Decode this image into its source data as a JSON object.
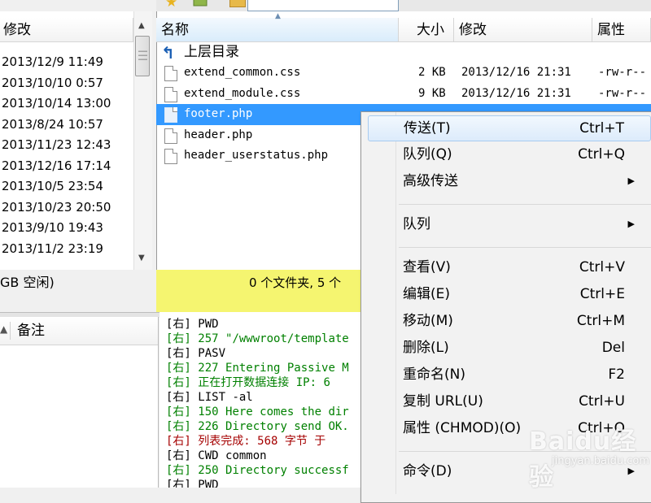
{
  "local": {
    "column_modified": "修改",
    "dates": [
      "2013/12/9 11:49",
      "2013/10/10 0:57",
      "2013/10/14 13:00",
      "2013/8/24 10:57",
      "2013/11/23 12:43",
      "2013/12/16 17:14",
      "2013/10/5 23:54",
      "2013/10/23 20:50",
      "2013/9/10 19:43",
      "2013/11/2 23:19"
    ],
    "status": "GB 空闲)"
  },
  "remote": {
    "columns": {
      "name": "名称",
      "size": "大小",
      "modified": "修改",
      "attr": "属性"
    },
    "parent_dir": "上层目录",
    "files": [
      {
        "name": "extend_common.css",
        "size": "2 KB",
        "modified": "2013/12/16 21:31",
        "perm": "-rw-r--"
      },
      {
        "name": "extend_module.css",
        "size": "9 KB",
        "modified": "2013/12/16 21:31",
        "perm": "-rw-r--"
      },
      {
        "name": "footer.php",
        "size": "",
        "modified": "",
        "perm": ""
      },
      {
        "name": "header.php",
        "size": "",
        "modified": "",
        "perm": ""
      },
      {
        "name": "header_userstatus.php",
        "size": "",
        "modified": "",
        "perm": ""
      }
    ],
    "status": "0 个文件夹, 5 个"
  },
  "queue": {
    "col_note": "备注"
  },
  "log": [
    {
      "tag": "[右]",
      "text": "PWD",
      "color": "black"
    },
    {
      "tag": "[右]",
      "text": "257 \"/wwwroot/template",
      "color": "green"
    },
    {
      "tag": "[右]",
      "text": "PASV",
      "color": "black"
    },
    {
      "tag": "[右]",
      "text": "227 Entering Passive M",
      "color": "green"
    },
    {
      "tag": "[右]",
      "text": "正在打开数据连接 IP: 6",
      "color": "green"
    },
    {
      "tag": "[右]",
      "text": "LIST -al",
      "color": "black"
    },
    {
      "tag": "[右]",
      "text": "150 Here comes the dir",
      "color": "green"
    },
    {
      "tag": "[右]",
      "text": "226 Directory send OK.",
      "color": "green"
    },
    {
      "tag": "[右]",
      "text": "列表完成: 568 字节 于",
      "color": "red"
    },
    {
      "tag": "[右]",
      "text": "CWD common",
      "color": "black"
    },
    {
      "tag": "[右]",
      "text": "250 Directory successf",
      "color": "green"
    },
    {
      "tag": "[右]",
      "text": "PWD",
      "color": "black"
    }
  ],
  "context_menu": {
    "items": [
      {
        "label": "传送(T)",
        "shortcut": "Ctrl+T",
        "submenu": false,
        "highlighted": true
      },
      {
        "label": "队列(Q)",
        "shortcut": "Ctrl+Q",
        "submenu": false,
        "highlighted": false
      },
      {
        "label": "高级传送",
        "shortcut": "",
        "submenu": true,
        "highlighted": false
      },
      {
        "separator": true
      },
      {
        "label": "队列",
        "shortcut": "",
        "submenu": true,
        "highlighted": false
      },
      {
        "separator": true
      },
      {
        "label": "查看(V)",
        "shortcut": "Ctrl+V",
        "submenu": false,
        "highlighted": false
      },
      {
        "label": "编辑(E)",
        "shortcut": "Ctrl+E",
        "submenu": false,
        "highlighted": false
      },
      {
        "label": "移动(M)",
        "shortcut": "Ctrl+M",
        "submenu": false,
        "highlighted": false
      },
      {
        "label": "删除(L)",
        "shortcut": "Del",
        "submenu": false,
        "highlighted": false
      },
      {
        "label": "重命名(N)",
        "shortcut": "F2",
        "submenu": false,
        "highlighted": false
      },
      {
        "label": "复制 URL(U)",
        "shortcut": "Ctrl+U",
        "submenu": false,
        "highlighted": false
      },
      {
        "label": "属性 (CHMOD)(O)",
        "shortcut": "Ctrl+O",
        "submenu": false,
        "highlighted": false
      },
      {
        "separator": true
      },
      {
        "label": "命令(D)",
        "shortcut": "",
        "submenu": true,
        "highlighted": false
      }
    ]
  },
  "watermark": {
    "logo": "Baidu经验",
    "url": "jingyan.baidu.com"
  },
  "colors": {
    "selection": "#3399ff",
    "status_bar": "#f5f570",
    "log_green": "#008000",
    "log_red": "#a50000",
    "menu_highlight_border": "#a8cbf0"
  }
}
